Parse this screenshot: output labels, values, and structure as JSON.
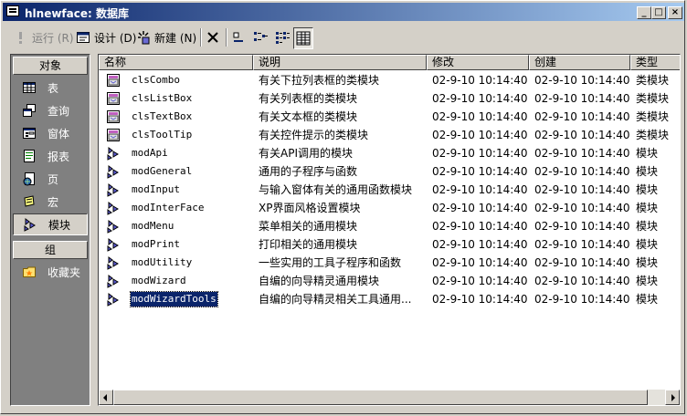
{
  "window": {
    "title": "hlnewface: 数据库"
  },
  "toolbar": {
    "run_label": "运行 (R)",
    "design_label": "设计 (D)",
    "new_label": "新建 (N)"
  },
  "sidebar": {
    "objects_header": "对象",
    "groups_header": "组",
    "items": [
      {
        "label": "表",
        "icon": "table-icon"
      },
      {
        "label": "查询",
        "icon": "query-icon"
      },
      {
        "label": "窗体",
        "icon": "form-icon"
      },
      {
        "label": "报表",
        "icon": "report-icon"
      },
      {
        "label": "页",
        "icon": "page-icon"
      },
      {
        "label": "宏",
        "icon": "macro-icon"
      },
      {
        "label": "模块",
        "icon": "module-icon",
        "selected": true
      }
    ],
    "groups": [
      {
        "label": "收藏夹",
        "icon": "favorites-icon"
      }
    ]
  },
  "list": {
    "columns": [
      "名称",
      "说明",
      "修改",
      "创建",
      "类型"
    ],
    "rows": [
      {
        "name": "clsCombo",
        "desc": "有关下拉列表框的类模块",
        "modified": "02-9-10 10:14:40",
        "created": "02-9-10 10:14:40",
        "type": "类模块",
        "kind": "class"
      },
      {
        "name": "clsListBox",
        "desc": "有关列表框的类模块",
        "modified": "02-9-10 10:14:40",
        "created": "02-9-10 10:14:40",
        "type": "类模块",
        "kind": "class"
      },
      {
        "name": "clsTextBox",
        "desc": "有关文本框的类模块",
        "modified": "02-9-10 10:14:40",
        "created": "02-9-10 10:14:40",
        "type": "类模块",
        "kind": "class"
      },
      {
        "name": "clsToolTip",
        "desc": "有关控件提示的类模块",
        "modified": "02-9-10 10:14:40",
        "created": "02-9-10 10:14:40",
        "type": "类模块",
        "kind": "class"
      },
      {
        "name": "modApi",
        "desc": "有关API调用的模块",
        "modified": "02-9-10 10:14:40",
        "created": "02-9-10 10:14:40",
        "type": "模块",
        "kind": "module"
      },
      {
        "name": "modGeneral",
        "desc": "通用的子程序与函数",
        "modified": "02-9-10 10:14:40",
        "created": "02-9-10 10:14:40",
        "type": "模块",
        "kind": "module"
      },
      {
        "name": "modInput",
        "desc": "与输入窗体有关的通用函数模块",
        "modified": "02-9-10 10:14:40",
        "created": "02-9-10 10:14:40",
        "type": "模块",
        "kind": "module"
      },
      {
        "name": "modInterFace",
        "desc": "XP界面风格设置模块",
        "modified": "02-9-10 10:14:40",
        "created": "02-9-10 10:14:40",
        "type": "模块",
        "kind": "module"
      },
      {
        "name": "modMenu",
        "desc": "菜单相关的通用模块",
        "modified": "02-9-10 10:14:40",
        "created": "02-9-10 10:14:40",
        "type": "模块",
        "kind": "module"
      },
      {
        "name": "modPrint",
        "desc": "打印相关的通用模块",
        "modified": "02-9-10 10:14:40",
        "created": "02-9-10 10:14:40",
        "type": "模块",
        "kind": "module"
      },
      {
        "name": "modUtility",
        "desc": "一些实用的工具子程序和函数",
        "modified": "02-9-10 10:14:40",
        "created": "02-9-10 10:14:40",
        "type": "模块",
        "kind": "module"
      },
      {
        "name": "modWizard",
        "desc": "自编的向导精灵通用模块",
        "modified": "02-9-10 10:14:40",
        "created": "02-9-10 10:14:40",
        "type": "模块",
        "kind": "module"
      },
      {
        "name": "modWizardTools",
        "desc": "自编的向导精灵相关工具通用...",
        "modified": "02-9-10 10:14:40",
        "created": "02-9-10 10:14:40",
        "type": "模块",
        "kind": "module",
        "selected": true
      }
    ]
  },
  "colors": {
    "title_start": "#0a246a",
    "title_end": "#a6caf0",
    "face": "#d4d0c8",
    "selection": "#0a246a"
  }
}
